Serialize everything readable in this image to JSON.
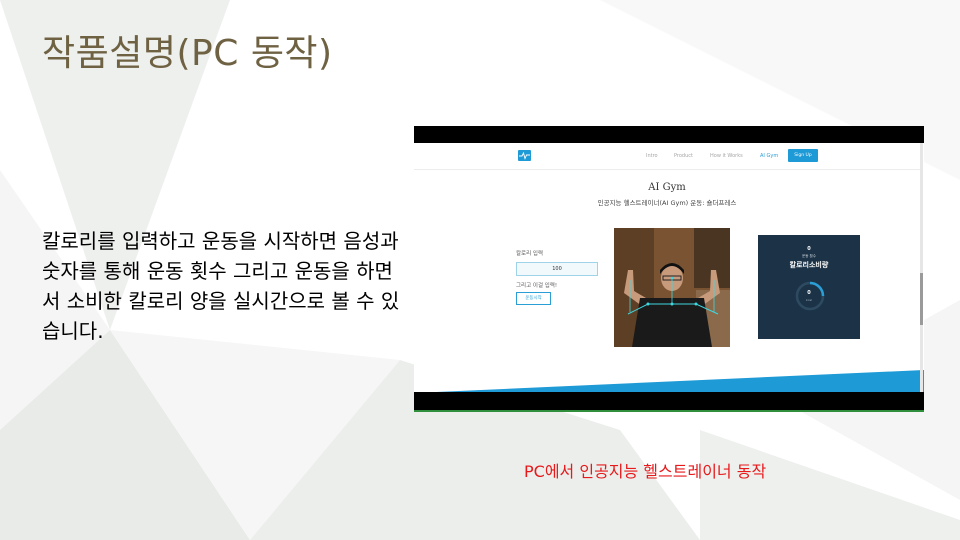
{
  "slide": {
    "title": "작품설명(PC 동작)",
    "body": "칼로리를 입력하고 운동을 시작하면 음성과 숫자를 통해 운동 횟수 그리고 운동을 하면서 소비한 칼로리 양을 실시간으로 볼 수 있습니다.",
    "caption": "PC에서 인공지능 헬스트레이너 동작"
  },
  "screenshot": {
    "nav": {
      "links": [
        "Intro",
        "Product",
        "How it Works",
        "AI Gym"
      ],
      "active": "AI Gym",
      "signup": "Sign Up"
    },
    "heading": "AI Gym",
    "subheading": "인공지능 헬스트레이너(AI Gym) 운동: 숄더프레스",
    "form": {
      "label": "칼로리 입력",
      "value": "100",
      "hint": "그리고 이걸 입력!",
      "button": "운동시작"
    },
    "stats": {
      "count": "0",
      "count_small": "운동 횟수",
      "calorie_label": "칼로리소비량",
      "ring_value": "0",
      "ring_unit": "kcal"
    }
  },
  "colors": {
    "title": "#6f6243",
    "caption": "#e8191b",
    "accent": "#1e9ad6",
    "card": "#1c3347"
  }
}
